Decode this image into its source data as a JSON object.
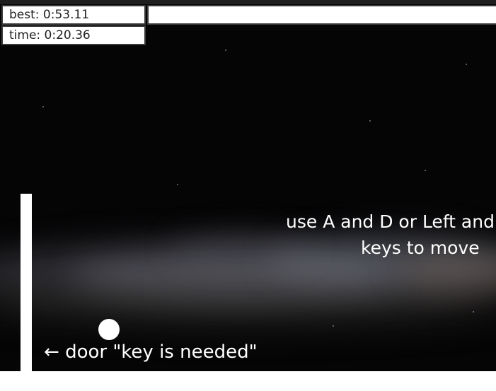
{
  "hud": {
    "best_label": "best: 0:53.11",
    "time_label": "time: 0:20.36",
    "progress_fraction": 1.0
  },
  "hints": {
    "controls_line1": "use A and D or Left and",
    "controls_line2": "keys to move",
    "door_arrow": "←",
    "door_text": "door \"key is needed\""
  },
  "colors": {
    "background": "#050506",
    "foreground": "#ffffff",
    "hud_border": "#3a3a3a"
  }
}
